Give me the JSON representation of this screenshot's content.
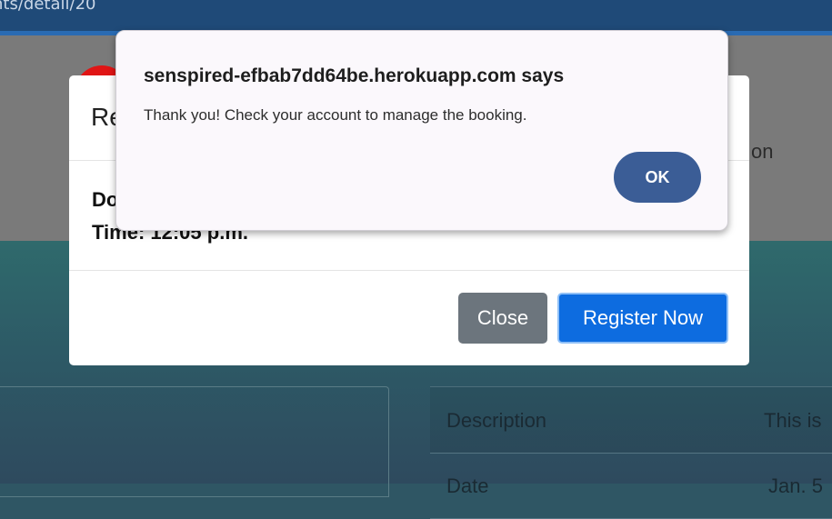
{
  "browser": {
    "url_fragment": "nts/detail/20"
  },
  "background": {
    "partial_text": "on",
    "table": {
      "rows": [
        {
          "label": "Description",
          "value": "This is"
        },
        {
          "label": "Date",
          "value": "Jan. 5"
        }
      ]
    }
  },
  "modal": {
    "title_partial": "Re",
    "body": {
      "line1_partial": "Do",
      "line2": "Time: 12:05 p.m."
    },
    "buttons": {
      "close": "Close",
      "register": "Register Now"
    }
  },
  "alert": {
    "title": "senspired-efbab7dd64be.herokuapp.com says",
    "message": "Thank you! Check your account to manage the booking.",
    "ok": "OK"
  },
  "colors": {
    "ok_button": "#3b5d96",
    "close_button": "#6c757d",
    "register_button": "#0d6ce0"
  }
}
